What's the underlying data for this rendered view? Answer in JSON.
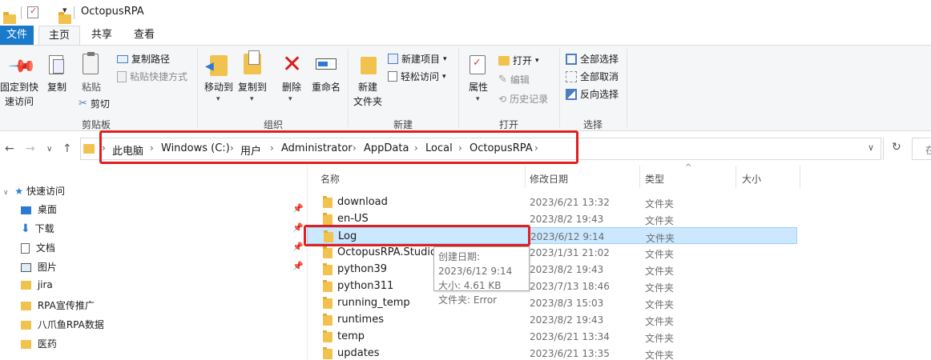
{
  "window": {
    "title": "OctopusRPA"
  },
  "tabs": {
    "file": "文件",
    "home": "主页",
    "share": "共享",
    "view": "查看"
  },
  "ribbon": {
    "pin_quick": "固定到快\n速访问",
    "pin_quick_l1": "固定到快",
    "pin_quick_l2": "速访问",
    "copy": "复制",
    "paste": "粘贴",
    "copy_path": "复制路径",
    "paste_shortcut": "粘贴快捷方式",
    "cut": "剪切",
    "clipboard_label": "剪贴板",
    "move_to": "移动到",
    "copy_to": "复制到",
    "delete": "删除",
    "rename": "重命名",
    "organize_label": "组织",
    "new_item": "新建项目",
    "easy_access": "轻松访问",
    "new_folder_l1": "新建",
    "new_folder_l2": "文件夹",
    "new_label": "新建",
    "properties": "属性",
    "open": "打开",
    "edit": "编辑",
    "history": "历史记录",
    "open_label": "打开",
    "select_all": "全部选择",
    "select_none": "全部取消",
    "invert_select": "反向选择",
    "select_label": "选择"
  },
  "address": {
    "crumbs": [
      "此电脑",
      "Windows (C:)",
      "用户",
      "Administrator",
      "AppData",
      "Local",
      "OctopusRPA"
    ],
    "search_partial": "在"
  },
  "nav": {
    "quick_access": "快速访问",
    "items": [
      {
        "label": "桌面",
        "pinned": true
      },
      {
        "label": "下载",
        "pinned": true
      },
      {
        "label": "文档",
        "pinned": true
      },
      {
        "label": "图片",
        "pinned": true
      },
      {
        "label": "jira",
        "pinned": false
      },
      {
        "label": "RPA宣传推广",
        "pinned": false
      },
      {
        "label": "八爪鱼RPA数据",
        "pinned": false
      },
      {
        "label": "医药",
        "pinned": false
      }
    ]
  },
  "columns": {
    "name": "名称",
    "date": "修改日期",
    "type": "类型",
    "size": "大小"
  },
  "files": [
    {
      "name": "download",
      "date": "2023/6/21 13:32",
      "type": "文件夹"
    },
    {
      "name": "en-US",
      "date": "2023/8/2 19:43",
      "type": "文件夹"
    },
    {
      "name": "Log",
      "date": "2023/6/12 9:14",
      "type": "文件夹",
      "selected": true
    },
    {
      "name": "OctopusRPA.Studio.exe.WebView2",
      "date": "2023/1/31 21:02",
      "type": "文件夹"
    },
    {
      "name": "python39",
      "date": "2023/8/2 19:43",
      "type": "文件夹"
    },
    {
      "name": "python311",
      "date": "2023/7/13 18:46",
      "type": "文件夹"
    },
    {
      "name": "running_temp",
      "date": "2023/8/3 15:03",
      "type": "文件夹"
    },
    {
      "name": "runtimes",
      "date": "2023/8/2 19:43",
      "type": "文件夹"
    },
    {
      "name": "temp",
      "date": "2023/6/21 13:34",
      "type": "文件夹"
    },
    {
      "name": "updates",
      "date": "2023/6/21 13:35",
      "type": "文件夹"
    }
  ],
  "tooltip": {
    "created": "创建日期: 2023/6/12 9:14",
    "size": "大小: 4.61 KB",
    "folders": "文件夹: Error"
  },
  "colors": {
    "accent": "#1979ca",
    "selection": "#cce8ff",
    "highlight_box": "#e02020",
    "folder": "#f2c24f"
  }
}
